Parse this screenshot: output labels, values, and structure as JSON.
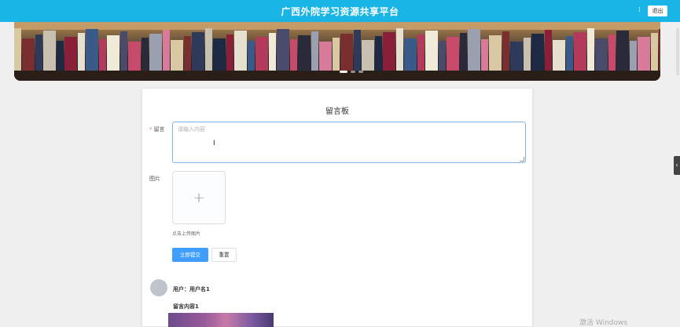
{
  "header": {
    "title": "广西外院学习资源共享平台",
    "logout_label": "退出"
  },
  "banner": {
    "slide_count": 3,
    "active_index": 0
  },
  "form": {
    "title": "留言板",
    "message_label": "留言",
    "message_placeholder": "请输入内容",
    "image_label": "图片",
    "upload_hint": "点击上传图片",
    "submit_label": "立即提交",
    "reset_label": "重置"
  },
  "comments": [
    {
      "user": "用户：用户名1",
      "content": "留言内容1"
    }
  ],
  "system": {
    "watermark": "激活 Windows"
  },
  "colors": {
    "header_bg": "#18b5e6",
    "primary": "#409eff"
  }
}
